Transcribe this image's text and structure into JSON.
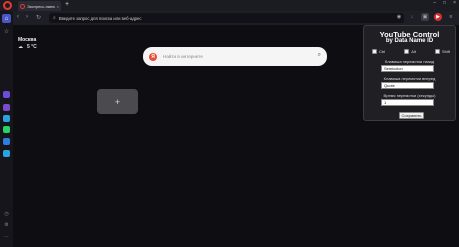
{
  "tabbar": {
    "tab_title": "Экспресс-панель",
    "tab_close_icon": "×",
    "new_tab_icon": "+",
    "window_controls": [
      "–",
      "□",
      "×"
    ]
  },
  "toolbar": {
    "address_placeholder": "Введите запрос для поиска или веб-адрес",
    "tool_icons": [
      "camera-icon",
      "download-icon",
      "cube-icon",
      "extension-icon",
      "menu-icon"
    ]
  },
  "weather": {
    "city": "Москва",
    "icon": "☁",
    "temp": "5 °C"
  },
  "search": {
    "placeholder": "Найти в интернете",
    "logo_letter": "Я"
  },
  "speed_dial": {
    "add_label": "+"
  },
  "popup": {
    "title": "YouTube Control",
    "subtitle": "by Data Name ID",
    "modifiers": [
      "Ctrl",
      "Alt",
      "Shift"
    ],
    "fields": [
      {
        "label": "Клавиша перемотки назад",
        "value": "Semicolon"
      },
      {
        "label": "Клавиша перемотки вперед",
        "value": "Quote"
      },
      {
        "label": "Время перемотки (секунды)",
        "value": "1"
      }
    ],
    "save_label": "Сохранить"
  },
  "colors": {
    "accent": "#4a55c8",
    "opera_red": "#e53935",
    "sidebar_apps": [
      "#6a4fd6",
      "#7a4cc9",
      "#25d366",
      "#2e7de0",
      "#2aa3e0"
    ]
  }
}
